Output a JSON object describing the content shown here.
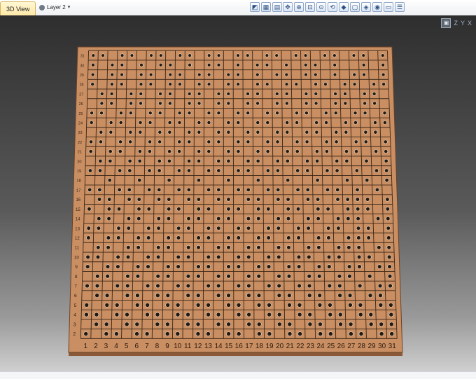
{
  "view_tab": {
    "label": "3D View"
  },
  "layer_selector": {
    "label": "Layer 2"
  },
  "toolbar": {
    "left_tools": [
      "3d-cube-icon",
      "grid-select-icon",
      "grid-icon"
    ],
    "right_tools": [
      "move-icon",
      "zoom-extents-icon",
      "zoom-window-icon",
      "zoom-selection-icon",
      "zoom-rotate-icon",
      "solid-shade-icon",
      "wireframe-icon",
      "material-icon",
      "render-icon",
      "layout-icon",
      "properties-icon"
    ]
  },
  "view_controls": {
    "axis_labels": [
      "Z",
      "Y",
      "X"
    ]
  },
  "board": {
    "material_color": "#c98e62",
    "row_labels": [
      "31",
      "30",
      "29",
      "28",
      "27",
      "26",
      "25",
      "24",
      "23",
      "22",
      "21",
      "20",
      "19",
      "18",
      "17",
      "16",
      "15",
      "14",
      "13",
      "12",
      "11",
      "10",
      "9",
      "8",
      "7",
      "6",
      "5",
      "4",
      "3",
      "2"
    ],
    "column_labels": [
      "1",
      "2",
      "3",
      "4",
      "5",
      "6",
      "7",
      "8",
      "9",
      "10",
      "11",
      "12",
      "13",
      "14",
      "15",
      "16",
      "17",
      "18",
      "19",
      "20",
      "21",
      "22",
      "23",
      "24",
      "25",
      "26",
      "27",
      "28",
      "29",
      "30",
      "31"
    ],
    "hole_pattern": [
      "1101101101101101101101101101101",
      "1011010110101101011010110100101",
      "1011011011011011010110110101101",
      "1011011011011011011011011011011",
      "0110110110110110110110110110110",
      "0110110110110110110110110110110",
      "1101101101101101101101101101101",
      "1011011011011011011011011011011",
      "0110110110110110110110110110110",
      "1101101101101101101101101101101",
      "1011011011011011011011011011011",
      "0110110110110110110110110110101",
      "1101101101101101101101101101011",
      "0010010010010010010010010010101",
      "1101101101101101101101101101010",
      "0110110110110110110110110111101",
      "1011011011011011011011011011101",
      "0110110110110110110110110111011",
      "1101101101101101101101101101101",
      "1011011011011011011011011011101",
      "0110110110110110110110110111011",
      "1101101101101101101101101101101",
      "1011011011011011011011011011011",
      "0110110110110110110110110110101",
      "1101101101101101101101101101011",
      "0110110110110110110110110110110",
      "1011011011011011011011011011011",
      "1101101101101101101101101101101",
      "0110110110110110110110110110111",
      "1011011011011011011011011011011"
    ]
  }
}
